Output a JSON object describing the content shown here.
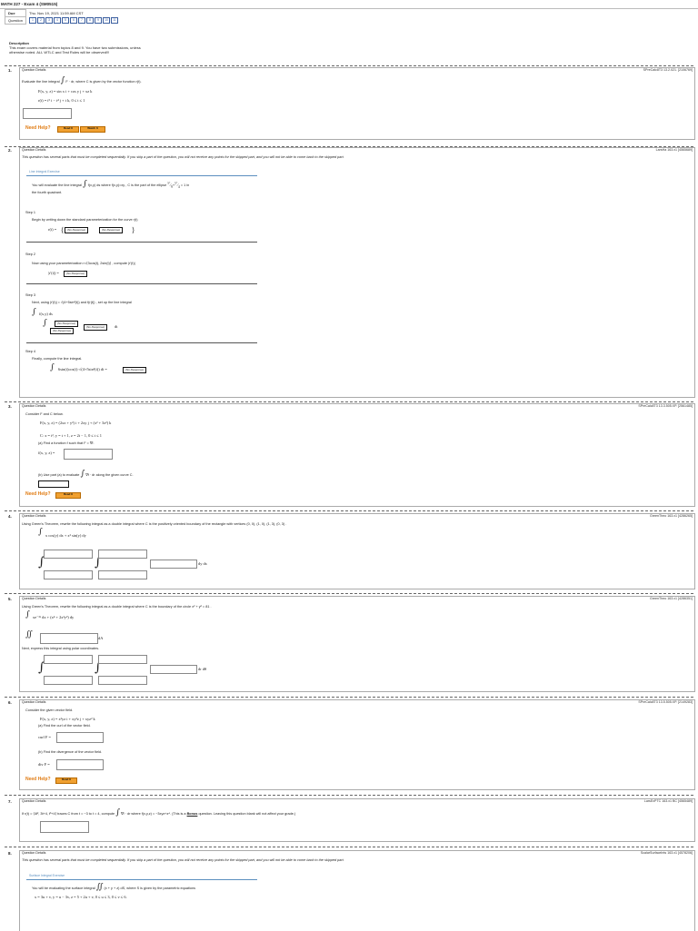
{
  "header": {
    "title": "MATH 227 - Exam 4 (SM0515)",
    "due_label": "Due",
    "due_value": "Thu. Nov 19, 2021 11:59 AM CST",
    "question_label": "Question",
    "question_numbers": [
      "1",
      "2",
      "3",
      "4",
      "5",
      "6",
      "7",
      "8",
      "9",
      "10",
      "11"
    ]
  },
  "description": {
    "heading": "Description",
    "line1": "This exam covers material from topics 8 and 9. You have two submissions, unless",
    "line2": "otherwise noted. ALL WTLC and Test Rules will be observed!!!"
  },
  "labels": {
    "question_details": "Question Details",
    "need_help": "Need Help?",
    "read_it": "Read It",
    "watch_it": "Watch It",
    "no_response": "(No Response)",
    "sequential_note": "This question has several parts that must be completed sequentially. If you skip a part of the question, you will not receive any points for the skipped part, and you will not be able to come back to the skipped part."
  },
  "q1": {
    "num": "1.",
    "ref": "SPreCalc8T3 13.2.021. [2106769]",
    "text_a": "Evaluate the line integral",
    "text_b": "F · dr,  where C is given by the vector function r(t).",
    "field": "F(x, y, z) = sin x i + cos y j + xz k",
    "curve": "r(t) = t⁵ i − t⁴ j + t k,   0 ≤ t ≤ 1"
  },
  "q2": {
    "num": "2.",
    "ref": "LarsHa 163.x1 [4565689]",
    "tutorial": "Line Integral Exercise",
    "intro_a": "You will evaluate the line integral",
    "intro_b": "f(x,y) ds where f(x,y)=xy ,  C  is the part of the ellipse",
    "intro_c": "= 1  in",
    "intro_d": "the fourth quadrant.",
    "step1": "Step 1",
    "step1_text": "Begin by writing down the standard parameterization for the curve  r(t)",
    "step1_eq": "r(t) =",
    "step2": "Step 2",
    "step2_text": "Now using your parameterization  r=⟨3cos(t), 2sin(t)⟩ , compute  |r′(t)|",
    "step2_eq": "|r′(t)| =",
    "step3": "Step 3",
    "step3_text": "Next, using  |r′(t)| = √(4+5sin²(t))  and f(r(t)) , set up the line integral",
    "step3_eq": "f(x,y) ds",
    "step4": "Step 4",
    "step4_text": "Finally, compute the line integral.",
    "step4_eq": "6sin(t)cos(t)·√(4+5sin²(t)) dt ="
  },
  "q3": {
    "num": "3.",
    "ref": "SPreCalc8T3 13.3.505.XP. [2561485]",
    "text": "Consider F and C below.",
    "field": "F(x, y, z) = (2xz + y²) i + 2xy j + (x² + 3z²) k",
    "curve": "C: x = t²,    y = t + 1,    z = 2t − 1,    0 ≤ t ≤ 1",
    "part_a": "(a) Find a function f such that F = ∇f.",
    "part_a_eq": "f(x, y, z) =",
    "part_b": "(b) Use part (a) to evaluate",
    "part_b_2": "∇f · dr  along the given curve C."
  },
  "q4": {
    "num": "4.",
    "ref": "GreenTheo 163.x1 [4286265]",
    "text": "Using Green's Theorem, rewrite the following integral as a double integral where  C  is the positively oriented boundary of the rectangle with vertices  (0, 0), (1, 0), (1, 3), (0, 3) .",
    "integrand": "x cos(y) dx + x² sin(y) dy",
    "tail": "dy dx"
  },
  "q5": {
    "num": "5.",
    "ref": "GreenTheo 163.x1 [4286351]",
    "text": "Using Green's Theorem, rewrite the following integral as a double integral where  C  is the boundary of the circle  x² + y² = 81 .",
    "integrand": "xe⁻²ˣ dx + (x⁴ + 2x²y²) dy",
    "da": "dA",
    "polar_text": "Next, express this integral using polar coordinates.",
    "tail": "dr dθ"
  },
  "q6": {
    "num": "6.",
    "ref": "SPreCalc8T3 13.5.505.XP. [2149283]",
    "text": "Consider the given vector field.",
    "field": "F(x, y, z) = x²yz i + xy²z j + xyz² k",
    "part_a": "(a) Find the curl of the vector field.",
    "part_a_eq": "curl F =",
    "part_b": "(b) Find the divergence of the vector field.",
    "part_b_eq": "div F ="
  },
  "q7": {
    "num": "7.",
    "ref": "LarsExPTC 163.x1 BC [4565489]",
    "text_a": "If r(t) = ⟨4t², 3t+4, t³+4⟩ traces C from  t = −3 to t = 4,  compute",
    "text_b": "∇f · dr  where f(x,y,z) = −3xyz+z⁴.  (This is a",
    "bonus": "Bonus",
    "text_c": "question. Leaving this question blank will not affect your grade.)"
  },
  "q8": {
    "num": "8.",
    "ref": "ScalarSurfaceInts 163.x1 [4578206]",
    "tutorial": "Surface Integral Exercise",
    "intro_a": "You will be evaluating the surface integral",
    "intro_b": "(x + y + z) dS,  where S is given by the parametric equations",
    "params": "x = 3u + v,   y = u − 3v,   z = 5 + 2u + v,   0 ≤ u ≤ 3,   0 ≤ v ≤ 6."
  }
}
